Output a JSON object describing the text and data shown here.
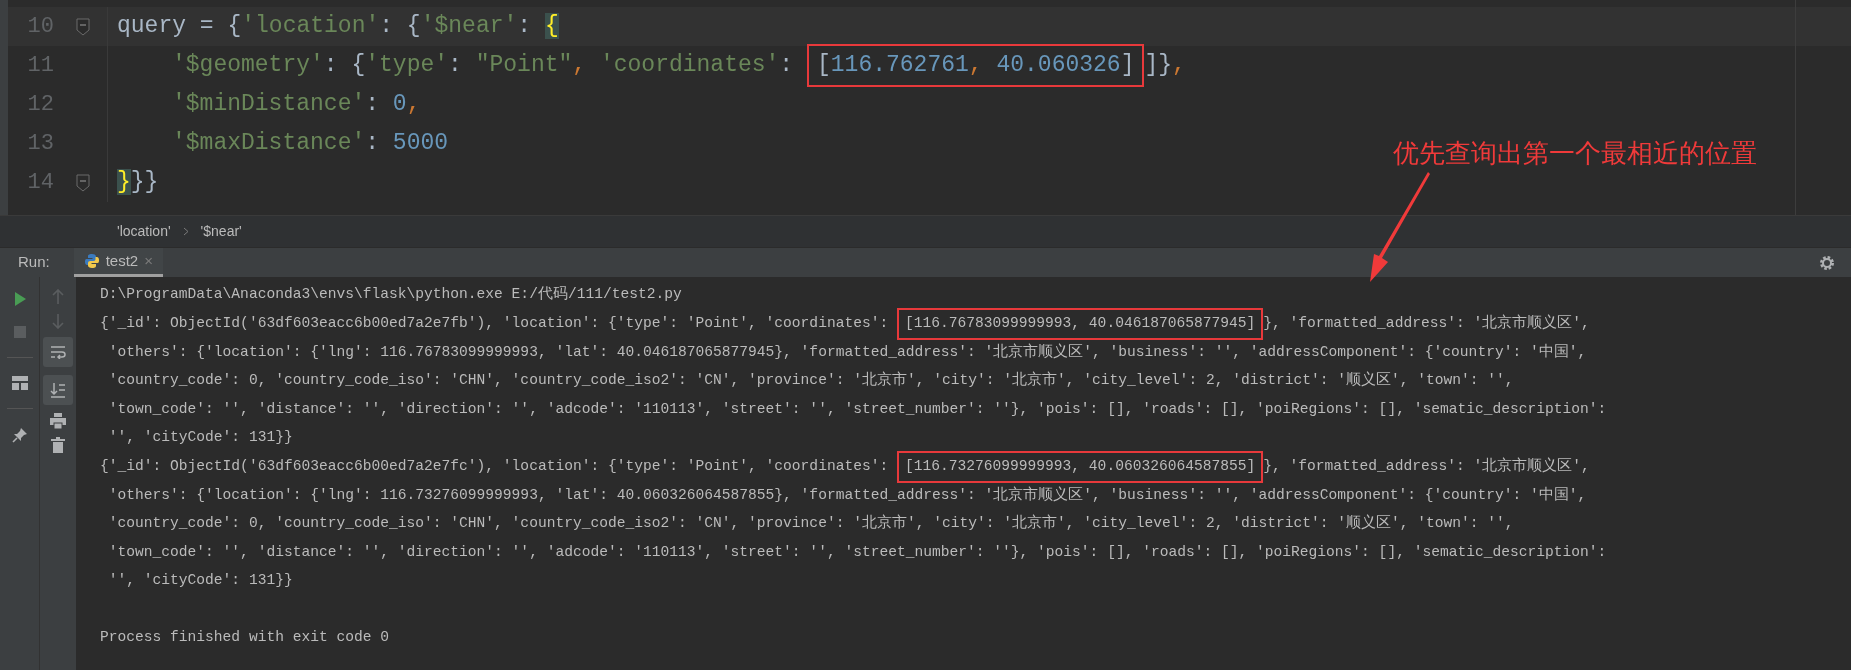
{
  "editor": {
    "lines": [
      {
        "number": "10",
        "current": true,
        "fold": true,
        "indented": false,
        "segments": [
          {
            "kind": "code",
            "tokens": [
              {
                "kind": "plain",
                "text": "query = {"
              },
              {
                "kind": "string",
                "text": "'location'"
              },
              {
                "kind": "plain",
                "text": ": {"
              },
              {
                "kind": "string",
                "text": "'$near'"
              },
              {
                "kind": "plain",
                "text": ": "
              },
              {
                "kind": "match",
                "text": "{"
              }
            ]
          }
        ]
      },
      {
        "number": "11",
        "current": false,
        "fold": false,
        "indented": true,
        "segments": [
          {
            "kind": "code",
            "tokens": [
              {
                "kind": "string",
                "text": "'$geometry'"
              },
              {
                "kind": "plain",
                "text": ": {"
              },
              {
                "kind": "string",
                "text": "'type'"
              },
              {
                "kind": "plain",
                "text": ": "
              },
              {
                "kind": "string",
                "text": "\"Point\""
              },
              {
                "kind": "punct",
                "text": ", "
              },
              {
                "kind": "string",
                "text": "'coordinates'"
              },
              {
                "kind": "plain",
                "text": ": "
              }
            ]
          },
          {
            "kind": "box",
            "tokens": [
              {
                "kind": "plain",
                "text": "["
              },
              {
                "kind": "number",
                "text": "116.762761"
              },
              {
                "kind": "punct",
                "text": ", "
              },
              {
                "kind": "number",
                "text": "40.060326"
              },
              {
                "kind": "plain",
                "text": "]"
              }
            ]
          },
          {
            "kind": "code",
            "tokens": [
              {
                "kind": "plain",
                "text": "]}"
              },
              {
                "kind": "punct",
                "text": ","
              }
            ]
          }
        ]
      },
      {
        "number": "12",
        "current": false,
        "fold": false,
        "indented": true,
        "segments": [
          {
            "kind": "code",
            "tokens": [
              {
                "kind": "string",
                "text": "'$minDistance'"
              },
              {
                "kind": "plain",
                "text": ": "
              },
              {
                "kind": "number",
                "text": "0"
              },
              {
                "kind": "punct",
                "text": ","
              }
            ]
          }
        ]
      },
      {
        "number": "13",
        "current": false,
        "fold": false,
        "indented": true,
        "segments": [
          {
            "kind": "code",
            "tokens": [
              {
                "kind": "string",
                "text": "'$maxDistance'"
              },
              {
                "kind": "plain",
                "text": ": "
              },
              {
                "kind": "number",
                "text": "5000"
              }
            ]
          }
        ]
      },
      {
        "number": "14",
        "current": false,
        "fold": true,
        "indented": false,
        "segments": [
          {
            "kind": "code",
            "tokens": [
              {
                "kind": "match",
                "text": "}"
              },
              {
                "kind": "plain",
                "text": "}}"
              }
            ]
          }
        ]
      }
    ],
    "breadcrumbs": [
      "'location'",
      "'$near'"
    ]
  },
  "run_panel": {
    "label": "Run:",
    "tabs": [
      {
        "title": "test2",
        "selected": true,
        "close": "×"
      }
    ],
    "toggles": {
      "soft_wrap": true,
      "scroll_to_end": true
    },
    "output": [
      {
        "kind": "command",
        "segments": [
          {
            "kind": "text",
            "text": "D:\\ProgramData\\Anaconda3\\envs\\flask\\python.exe E:/代码/111/test2.py"
          }
        ]
      },
      {
        "kind": "output",
        "segments": [
          {
            "kind": "text",
            "text": "{'_id': ObjectId('63df603eacc6b00ed7a2e7fb'), 'location': {'type': 'Point', 'coordinates': "
          },
          {
            "kind": "box",
            "text": "[116.76783099999993, 40.046187065877945]"
          },
          {
            "kind": "text",
            "text": "}, 'formatted_address': '北京市顺义区',"
          }
        ]
      },
      {
        "kind": "output",
        "segments": [
          {
            "kind": "text",
            "text": " 'others': {'location': {'lng': 116.76783099999993, 'lat': 40.046187065877945}, 'formatted_address': '北京市顺义区', 'business': '', 'addressComponent': {'country': '中国',"
          }
        ]
      },
      {
        "kind": "output",
        "segments": [
          {
            "kind": "text",
            "text": " 'country_code': 0, 'country_code_iso': 'CHN', 'country_code_iso2': 'CN', 'province': '北京市', 'city': '北京市', 'city_level': 2, 'district': '顺义区', 'town': '',"
          }
        ]
      },
      {
        "kind": "output",
        "segments": [
          {
            "kind": "text",
            "text": " 'town_code': '', 'distance': '', 'direction': '', 'adcode': '110113', 'street': '', 'street_number': ''}, 'pois': [], 'roads': [], 'poiRegions': [], 'sematic_description':"
          }
        ]
      },
      {
        "kind": "output",
        "segments": [
          {
            "kind": "text",
            "text": " '', 'cityCode': 131}}"
          }
        ]
      },
      {
        "kind": "output",
        "segments": [
          {
            "kind": "text",
            "text": "{'_id': ObjectId('63df603eacc6b00ed7a2e7fc'), 'location': {'type': 'Point', 'coordinates': "
          },
          {
            "kind": "box",
            "text": "[116.73276099999993, 40.060326064587855]"
          },
          {
            "kind": "text",
            "text": "}, 'formatted_address': '北京市顺义区',"
          }
        ]
      },
      {
        "kind": "output",
        "segments": [
          {
            "kind": "text",
            "text": " 'others': {'location': {'lng': 116.73276099999993, 'lat': 40.060326064587855}, 'formatted_address': '北京市顺义区', 'business': '', 'addressComponent': {'country': '中国',"
          }
        ]
      },
      {
        "kind": "output",
        "segments": [
          {
            "kind": "text",
            "text": " 'country_code': 0, 'country_code_iso': 'CHN', 'country_code_iso2': 'CN', 'province': '北京市', 'city': '北京市', 'city_level': 2, 'district': '顺义区', 'town': '',"
          }
        ]
      },
      {
        "kind": "output",
        "segments": [
          {
            "kind": "text",
            "text": " 'town_code': '', 'distance': '', 'direction': '', 'adcode': '110113', 'street': '', 'street_number': ''}, 'pois': [], 'roads': [], 'poiRegions': [], 'sematic_description':"
          }
        ]
      },
      {
        "kind": "output",
        "segments": [
          {
            "kind": "text",
            "text": " '', 'cityCode': 131}}"
          }
        ]
      },
      {
        "kind": "status",
        "segments": [
          {
            "kind": "text",
            "text": "Process finished with exit code 0"
          }
        ]
      }
    ]
  },
  "annotation": {
    "text": "优先查询出第一个最相近的位置"
  }
}
